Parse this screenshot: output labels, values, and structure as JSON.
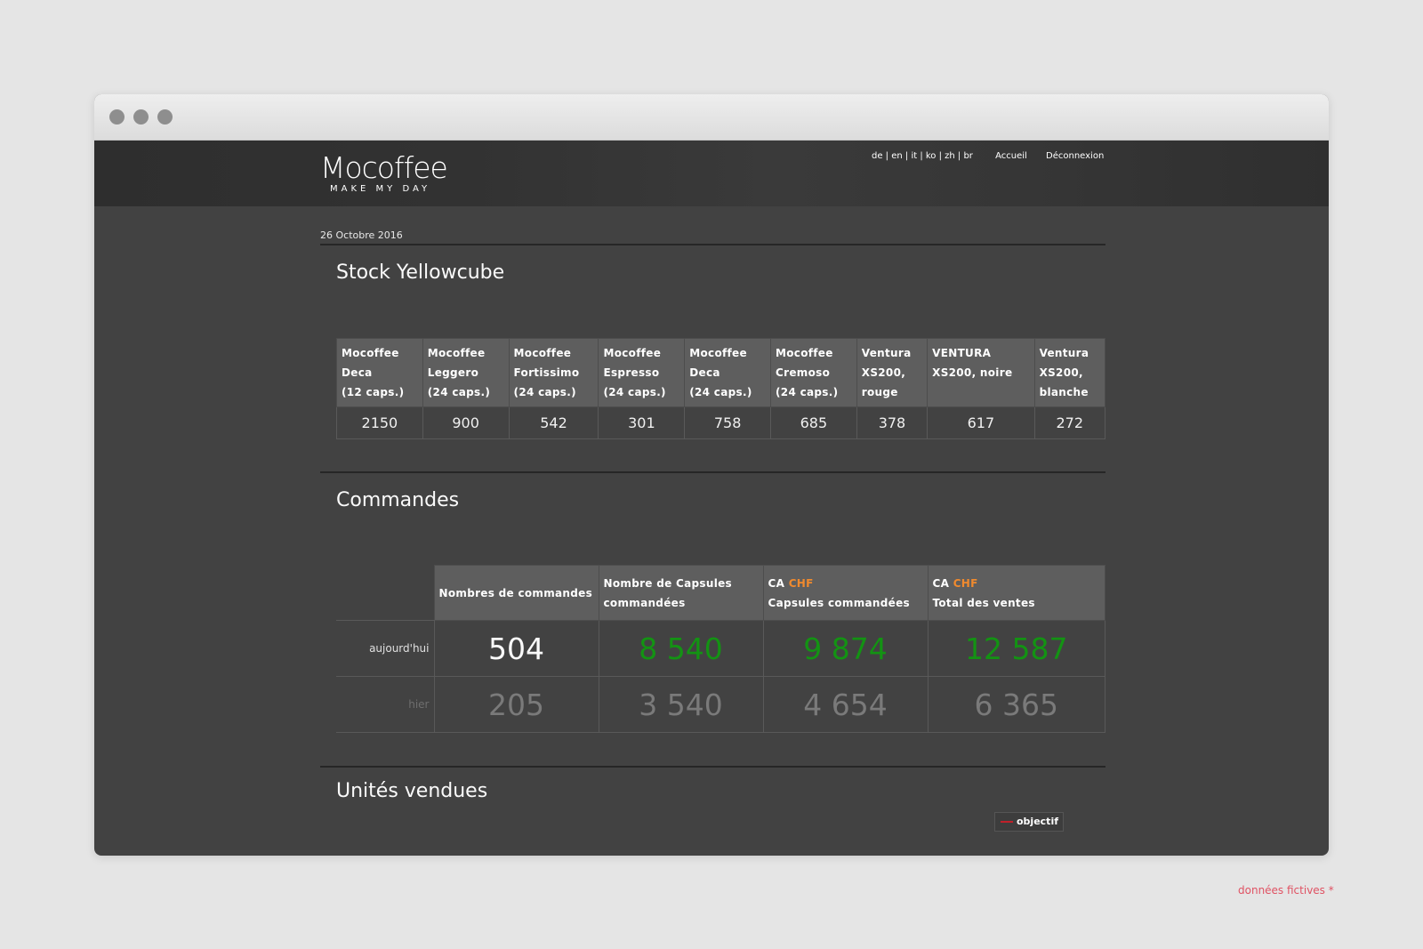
{
  "header": {
    "logo_main": "Mocoffee",
    "logo_tagline": "MAKE MY DAY",
    "languages": "de | en | it | ko | zh | br",
    "home_link": "Accueil",
    "logout_link": "Déconnexion"
  },
  "date": "26 Octobre 2016",
  "stock": {
    "title": "Stock Yellowcube",
    "columns": [
      {
        "line1": "Mocoffee",
        "line2": "Deca",
        "line3": "(12 caps.)",
        "value": "2150"
      },
      {
        "line1": "Mocoffee",
        "line2": "Leggero",
        "line3": "(24 caps.)",
        "value": "900"
      },
      {
        "line1": "Mocoffee",
        "line2": "Fortissimo",
        "line3": "(24 caps.)",
        "value": "542"
      },
      {
        "line1": "Mocoffee",
        "line2": "Espresso",
        "line3": "(24 caps.)",
        "value": "301"
      },
      {
        "line1": "Mocoffee",
        "line2": "Deca",
        "line3": "(24 caps.)",
        "value": "758"
      },
      {
        "line1": "Mocoffee",
        "line2": "Cremoso",
        "line3": "(24 caps.)",
        "value": "685"
      },
      {
        "line1": "Ventura",
        "line2": "XS200,",
        "line3": "rouge",
        "value": "378"
      },
      {
        "line1": "VENTURA",
        "line2": "XS200, noire",
        "line3": "",
        "value": "617"
      },
      {
        "line1": "Ventura",
        "line2": "XS200,",
        "line3": "blanche",
        "value": "272"
      }
    ]
  },
  "orders": {
    "title": "Commandes",
    "headers": {
      "col1": "Nombres de commandes",
      "col2_line1": "Nombre de Capsules",
      "col2_line2": "commandées",
      "col3_prefix": "CA",
      "col3_currency": "CHF",
      "col3_line2": "Capsules commandées",
      "col4_prefix": "CA",
      "col4_currency": "CHF",
      "col4_line2": "Total des ventes"
    },
    "today": {
      "label": "aujourd'hui",
      "orders": "504",
      "capsules": "8 540",
      "ca_capsules": "9 874",
      "ca_total": "12 587"
    },
    "yesterday": {
      "label": "hier",
      "orders": "205",
      "capsules": "3 540",
      "ca_capsules": "4 654",
      "ca_total": "6 365"
    }
  },
  "units": {
    "title": "Unités vendues",
    "legend_label": "objectif",
    "legend_color": "#c0202a"
  },
  "footnote": "données fictives *",
  "colors": {
    "positive": "#139313",
    "currency": "#f08a2e"
  }
}
